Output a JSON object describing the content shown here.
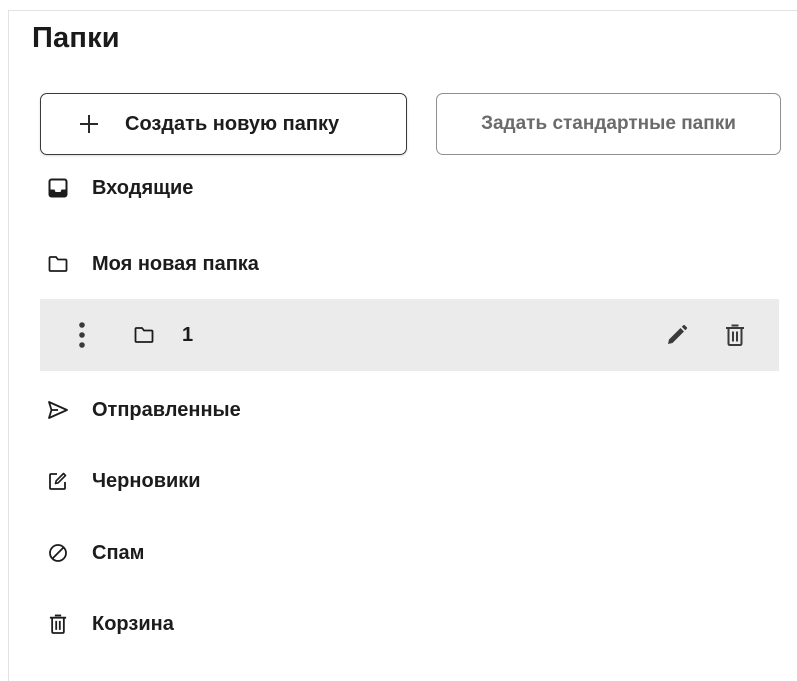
{
  "title": "Папки",
  "buttons": {
    "create_label": "Создать новую папку",
    "default_label": "Задать стандартные папки"
  },
  "folders": [
    {
      "label": "Входящие",
      "icon": "inbox-icon"
    },
    {
      "label": "Моя новая папка",
      "icon": "folder-icon"
    },
    {
      "label": "1",
      "icon": "folder-icon",
      "selected": true,
      "actions": [
        "edit-icon",
        "trash-icon"
      ]
    },
    {
      "label": "Отправленные",
      "icon": "send-icon"
    },
    {
      "label": "Черновики",
      "icon": "draft-icon"
    },
    {
      "label": "Спам",
      "icon": "spam-icon"
    },
    {
      "label": "Корзина",
      "icon": "trash-icon"
    }
  ],
  "colors": {
    "text": "#1c1c1c",
    "selected_row": "#ebebeb",
    "secondary_button_text": "#6b6b6b",
    "border": "#3a3a3a"
  }
}
